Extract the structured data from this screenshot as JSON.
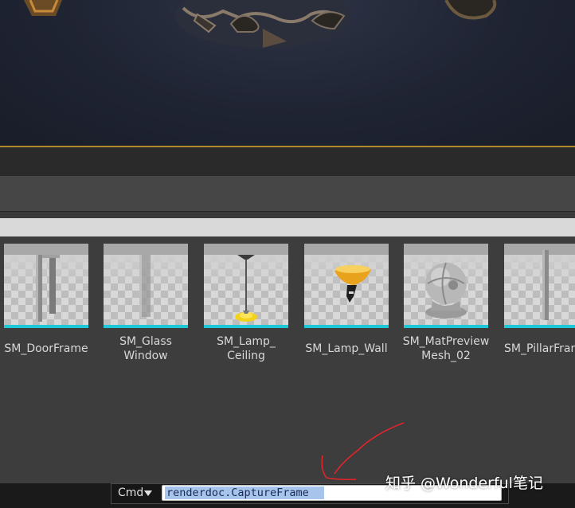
{
  "assets": [
    {
      "name": "SM_DoorFrame",
      "label": "SM_DoorFrame",
      "icon": "doorframe-mesh-icon"
    },
    {
      "name": "SM_Glass Window",
      "label": "SM_Glass\nWindow",
      "icon": "glass-window-mesh-icon"
    },
    {
      "name": "SM_Lamp_ Ceiling",
      "label": "SM_Lamp_\nCeiling",
      "icon": "ceiling-lamp-mesh-icon"
    },
    {
      "name": "SM_Lamp_Wall",
      "label": "SM_Lamp_Wall",
      "icon": "wall-lamp-mesh-icon"
    },
    {
      "name": "SM_MatPreview Mesh_02",
      "label": "SM_MatPreview\nMesh_02",
      "icon": "matpreview-sphere-icon"
    },
    {
      "name": "SM_PillarFrame",
      "label": "SM_PillarFran",
      "icon": "pillar-mesh-icon"
    }
  ],
  "console": {
    "mode_label": "Cmd",
    "command_value": "renderdoc.CaptureFrame"
  },
  "watermark": "知乎 @Wonderful笔记",
  "colors": {
    "accent_cyan": "#1ec8d8",
    "viewport_border": "#b08a2a",
    "annotation_red": "#e0242a"
  }
}
